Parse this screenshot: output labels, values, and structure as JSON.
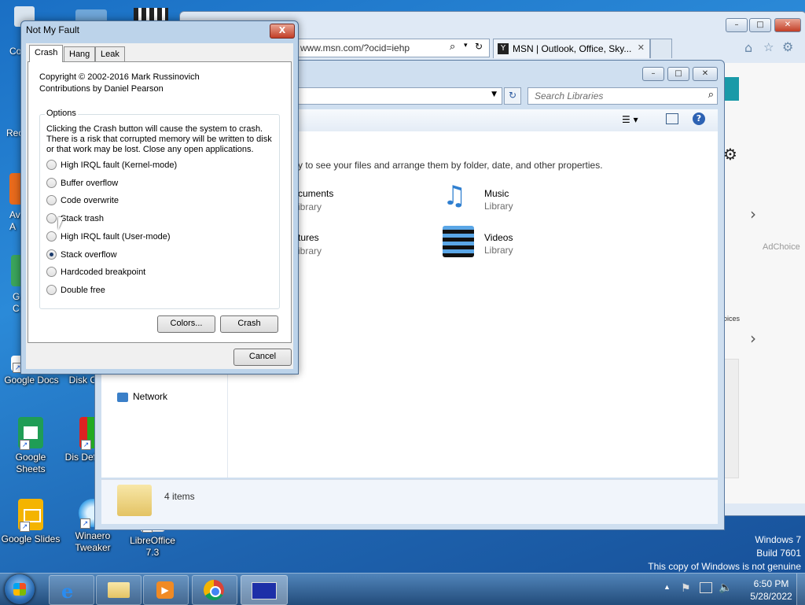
{
  "desktop": {
    "icons": [
      {
        "label": "Google Docs"
      },
      {
        "label": "Disk Cle"
      },
      {
        "label": "Google Sheets"
      },
      {
        "label": "Dis Defragm"
      },
      {
        "label": "Google Slides"
      },
      {
        "label": "Winaero Tweaker"
      },
      {
        "label": "LibreOffice 7.3"
      }
    ],
    "partial_labels": [
      "Co",
      "Rec",
      "Av",
      "A",
      "G",
      "C"
    ],
    "watermark": {
      "line1": "Windows 7",
      "line2": "Build 7601",
      "line3": "This copy of Windows is not genuine"
    }
  },
  "ie": {
    "address": "www.msn.com/?ocid=iehp",
    "tab_title": "MSN | Outlook, Office, Sky...",
    "side_labels": [
      "AdChoice",
      "oices"
    ]
  },
  "explorer": {
    "search_placeholder": "Search Libraries",
    "intro": "y to see your files and arrange them by folder, date, and other properties.",
    "libraries": [
      {
        "name": "cuments",
        "type": "ibrary"
      },
      {
        "name": "Music",
        "type": "Library"
      },
      {
        "name": "tures",
        "type": "ibrary"
      },
      {
        "name": "Videos",
        "type": "Library"
      }
    ],
    "nav_network": "Network",
    "status": "4 items"
  },
  "dialog": {
    "title": "Not My Fault",
    "tabs": [
      "Crash",
      "Hang",
      "Leak"
    ],
    "selected_tab": "Crash",
    "copyright": "Copyright © 2002-2016 Mark Russinovich",
    "contributions": "Contributions by Daniel Pearson",
    "options_label": "Options",
    "description": "Clicking the Crash button will cause the system to crash. There is a risk that corrupted memory will be written to disk or that work may be lost. Close any open applications.",
    "options": [
      {
        "label": "High IRQL fault (Kernel-mode)",
        "selected": false
      },
      {
        "label": "Buffer overflow",
        "selected": false
      },
      {
        "label": "Code overwrite",
        "selected": false
      },
      {
        "label": "Stack trash",
        "selected": false
      },
      {
        "label": "High IRQL fault (User-mode)",
        "selected": false
      },
      {
        "label": "Stack overflow",
        "selected": true
      },
      {
        "label": "Hardcoded breakpoint",
        "selected": false
      },
      {
        "label": "Double free",
        "selected": false
      }
    ],
    "colors_button": "Colors...",
    "crash_button": "Crash",
    "cancel_button": "Cancel",
    "close_glyph": "X"
  },
  "taskbar": {
    "time": "6:50 PM",
    "date": "5/28/2022"
  },
  "colors": {
    "desktop": "#1a6fc4",
    "dialog_frame": "#bcd3ea",
    "close_red": "#c23e26"
  }
}
